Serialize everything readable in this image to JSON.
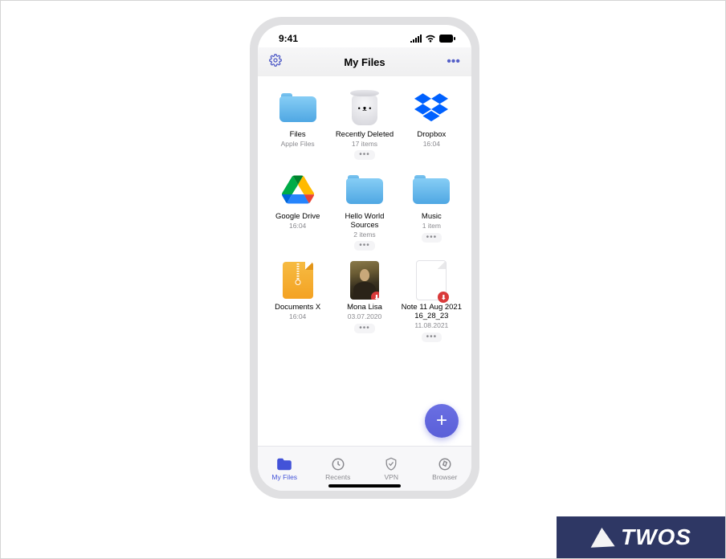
{
  "status": {
    "time": "9:41"
  },
  "nav": {
    "title": "My Files"
  },
  "items": [
    {
      "name": "Files",
      "sub": "Apple Files",
      "more": false,
      "icon": "apple-folder"
    },
    {
      "name": "Recently Deleted",
      "sub": "17 items",
      "more": true,
      "icon": "trash"
    },
    {
      "name": "Dropbox",
      "sub": "16:04",
      "more": false,
      "icon": "dropbox"
    },
    {
      "name": "Google Drive",
      "sub": "16:04",
      "more": false,
      "icon": "gdrive"
    },
    {
      "name": "Hello World Sources",
      "sub": "2 items",
      "more": true,
      "icon": "folder"
    },
    {
      "name": "Music",
      "sub": "1 item",
      "more": true,
      "icon": "folder"
    },
    {
      "name": "Documents X",
      "sub": "16:04",
      "more": false,
      "icon": "zip"
    },
    {
      "name": "Mona Lisa",
      "sub": "03.07.2020",
      "more": true,
      "icon": "mona",
      "badge": "pdf"
    },
    {
      "name": "Note 11 Aug 2021 16_28_23",
      "sub": "11.08.2021",
      "more": true,
      "icon": "note",
      "badge": "pdf"
    }
  ],
  "tabs": [
    {
      "label": "My Files",
      "icon": "folder-icon",
      "active": true
    },
    {
      "label": "Recents",
      "icon": "clock-icon",
      "active": false
    },
    {
      "label": "VPN",
      "icon": "shield-icon",
      "active": false
    },
    {
      "label": "Browser",
      "icon": "compass-icon",
      "active": false
    }
  ],
  "brand": {
    "text": "TWOS"
  },
  "colors": {
    "accent": "#5a5fd8",
    "tab_inactive": "#8a8a8f"
  }
}
